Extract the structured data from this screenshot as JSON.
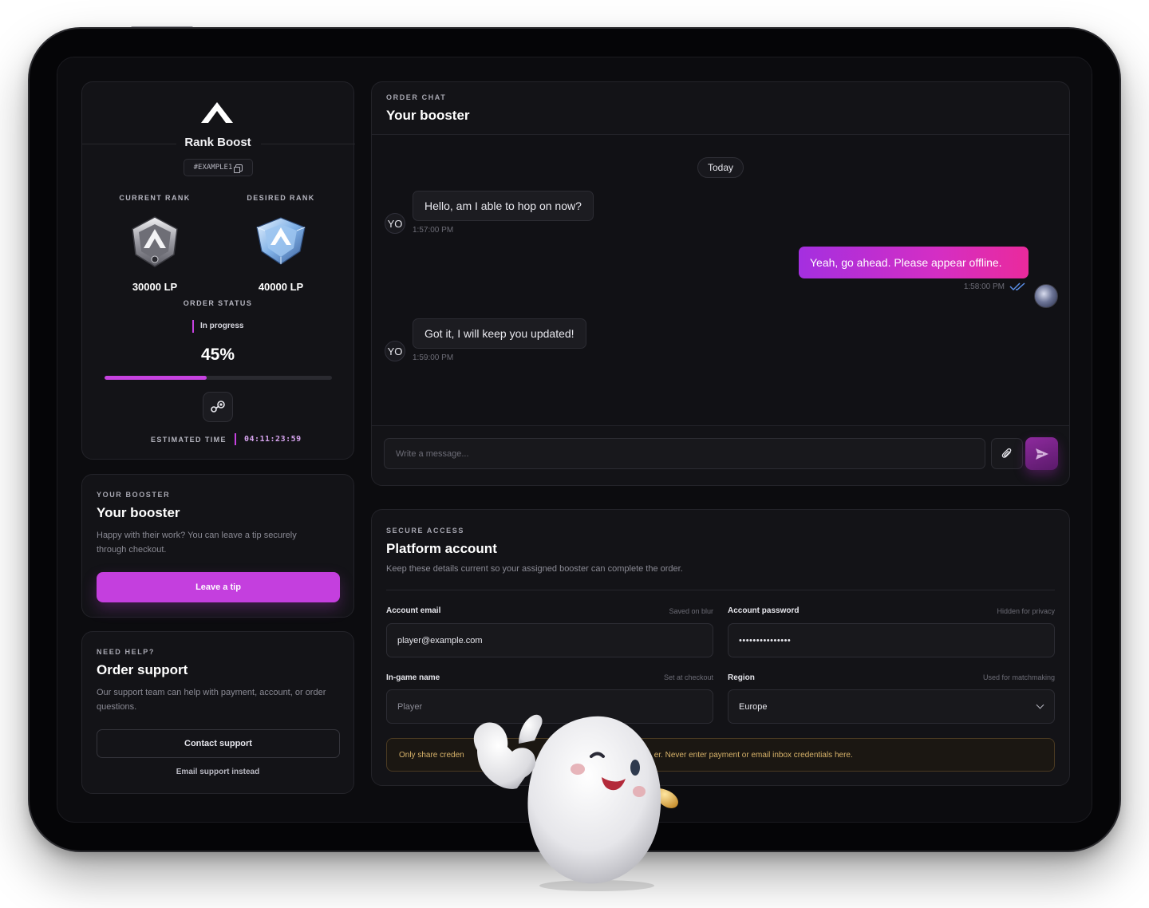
{
  "order": {
    "title": "Rank Boost",
    "order_id": "#EXAMPLE1",
    "current_rank_label": "CURRENT RANK",
    "desired_rank_label": "DESIRED RANK",
    "current_lp": "30000 LP",
    "desired_lp": "40000 LP",
    "status_label": "ORDER STATUS",
    "status_value": "In progress",
    "progress_text": "45%",
    "progress_fraction": 0.45,
    "estimated_time_label": "ESTIMATED TIME",
    "estimated_time": "04:11:23:59",
    "platform_icon": "steam-icon",
    "accent_color": "#c642e0"
  },
  "booster": {
    "eyebrow": "YOUR BOOSTER",
    "title": "Your booster",
    "description": "Happy with their work? You can leave a tip securely through checkout.",
    "tip_label": "Leave a tip"
  },
  "support": {
    "eyebrow": "NEED HELP?",
    "title": "Order support",
    "description": "Our support team can help with payment, account, or order questions.",
    "contact_label": "Contact support",
    "email_label": "Email support instead"
  },
  "chat": {
    "eyebrow": "ORDER CHAT",
    "title": "Your booster",
    "day_label": "Today",
    "avatar_initials": "YO",
    "messages": [
      {
        "direction": "in",
        "text": "Hello, am I able to hop on now?",
        "time": "1:57:00 PM"
      },
      {
        "direction": "out",
        "text": "Yeah, go ahead. Please appear offline.",
        "time": "1:58:00 PM",
        "read": true
      },
      {
        "direction": "in",
        "text": "Got it, I will keep you updated!",
        "time": "1:59:00 PM"
      }
    ],
    "input_placeholder": "Write a message...",
    "attach_icon": "paperclip-icon",
    "send_icon": "send-icon"
  },
  "account": {
    "eyebrow": "SECURE ACCESS",
    "title": "Platform account",
    "description": "Keep these details current so your assigned booster can complete the order.",
    "email_label": "Account email",
    "email_hint": "Saved on blur",
    "email_value": "player@example.com",
    "password_label": "Account password",
    "password_hint": "Hidden for privacy",
    "password_value": "•••••••••••••••",
    "ign_label": "In-game name",
    "ign_hint": "Set at checkout",
    "ign_value": "Player",
    "region_label": "Region",
    "region_hint": "Used for matchmaking",
    "region_value": "Europe",
    "warning_visible_start": "Only share creden",
    "warning_visible_end": "er. Never enter payment or email inbox credentials here."
  }
}
